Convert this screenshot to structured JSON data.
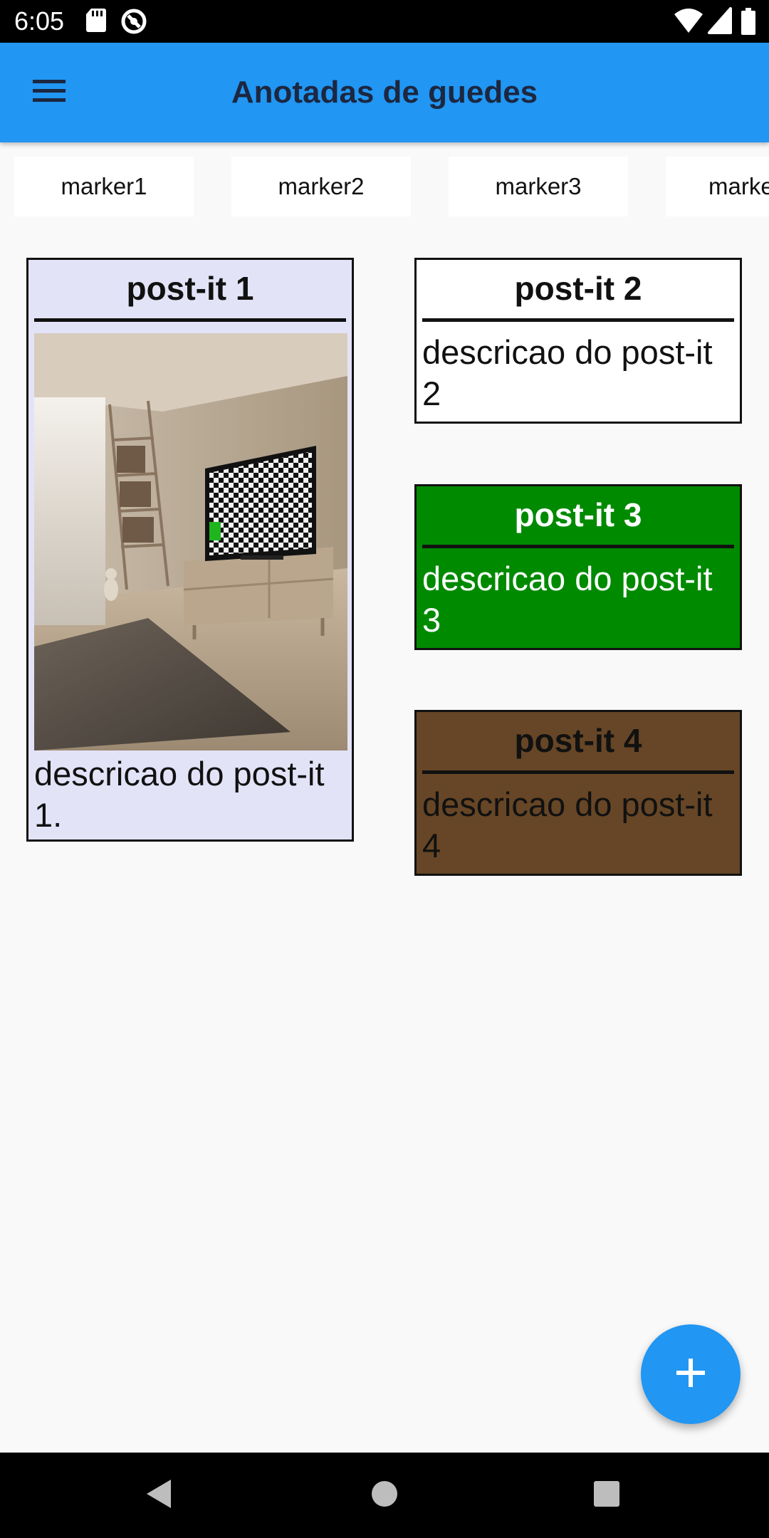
{
  "status_bar": {
    "time": "6:05",
    "icons": [
      "sd-card-icon",
      "data-saver-icon",
      "wifi-icon",
      "signal-icon",
      "battery-icon"
    ]
  },
  "app_bar": {
    "title": "Anotadas de guedes",
    "menu_icon": "hamburger-menu-icon",
    "color": "#2196F3"
  },
  "markers": [
    {
      "label": "marker1"
    },
    {
      "label": "marker2"
    },
    {
      "label": "marker3"
    },
    {
      "label": "marke"
    }
  ],
  "postits": [
    {
      "title": "post-it 1",
      "description": "descricao do post-it 1.",
      "background": "#E3E3F8",
      "text_color": "#111111",
      "has_image": true,
      "image": "room-with-tv-image"
    },
    {
      "title": "post-it 2",
      "description": "descricao do post-it 2",
      "background": "#FFFFFF",
      "text_color": "#111111",
      "has_image": false
    },
    {
      "title": "post-it 3",
      "description": "descricao do post-it 3",
      "background": "#008A00",
      "text_color": "#FFFFFF",
      "has_image": false
    },
    {
      "title": "post-it 4",
      "description": "descricao do post-it 4",
      "background": "#664626",
      "text_color": "#111111",
      "has_image": false
    }
  ],
  "fab": {
    "icon": "plus-icon",
    "color": "#2196F3"
  },
  "nav_bar": {
    "icons": [
      "back-icon",
      "home-icon",
      "recents-icon"
    ]
  }
}
